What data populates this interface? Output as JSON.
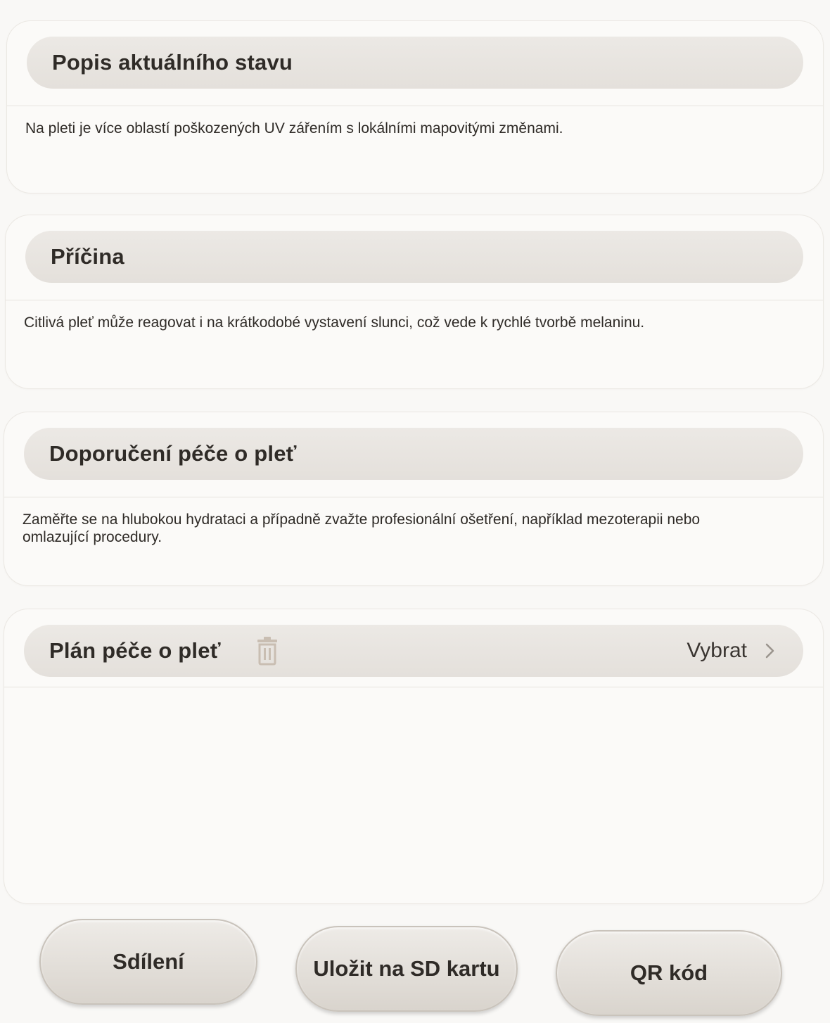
{
  "sections": [
    {
      "title": "Popis aktuálního stavu",
      "text": "Na pleti je více oblastí poškozených UV zářením s lokálními mapovitými změnami."
    },
    {
      "title": "Příčina",
      "text": "Citlivá pleť může reagovat i na krátkodobé vystavení slunci, což vede k rychlé tvorbě melaninu."
    },
    {
      "title": "Doporučení péče o pleť",
      "text": "Zaměřte se na hlubokou hydrataci a případně zvažte profesionální ošetření, například mezoterapii nebo omlazující procedury."
    }
  ],
  "plan": {
    "title": "Plán péče o pleť",
    "select_label": "Vybrat",
    "icons": [
      "trash-icon",
      "chevron-right-icon"
    ]
  },
  "buttons": {
    "share": "Sdílení",
    "save_sd": "Uložit na SD kartu",
    "qr": "QR kód"
  },
  "colors": {
    "background": "#f9f8f6",
    "header_fill": "#e8e4df",
    "icon_tint": "#c9beb2",
    "text": "#2f2b27"
  }
}
